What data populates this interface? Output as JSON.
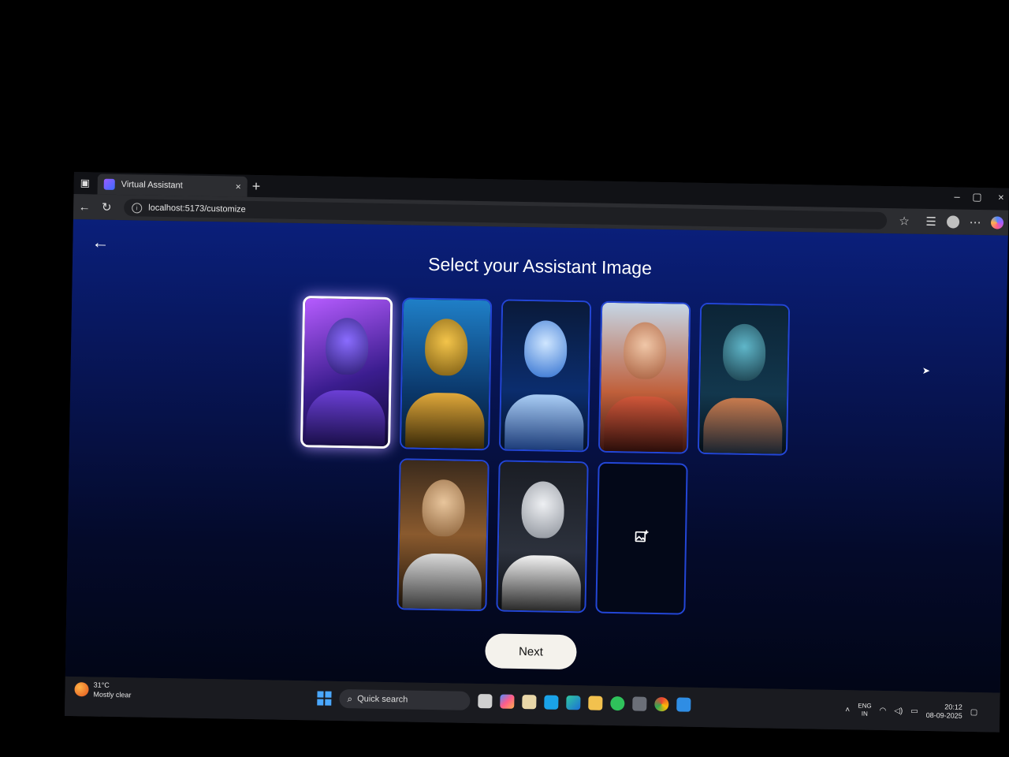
{
  "browser": {
    "tab_title": "Virtual Assistant",
    "tab_close": "×",
    "new_tab": "+",
    "url": "localhost:5173/customize",
    "window_controls": [
      "–",
      "▢",
      "×"
    ]
  },
  "page": {
    "back_icon": "←",
    "title": "Select your Assistant Image",
    "next_label": "Next",
    "upload_icon": "image-plus-icon",
    "cards": [
      {
        "name": "purple-cyborg",
        "selected": true
      },
      {
        "name": "gold-robot",
        "selected": false
      },
      {
        "name": "blue-armor-robot",
        "selected": false
      },
      {
        "name": "cyborg-woman-red",
        "selected": false
      },
      {
        "name": "cyborg-woman-blue",
        "selected": false
      },
      {
        "name": "gold-android-woman",
        "selected": false
      },
      {
        "name": "white-android-woman",
        "selected": false
      }
    ]
  },
  "taskbar": {
    "weather_temp": "31°C",
    "weather_desc": "Mostly clear",
    "search_placeholder": "Quick search",
    "lang_top": "ENG",
    "lang_bottom": "IN",
    "time": "20:12",
    "date": "08-09-2025"
  },
  "colors": {
    "accent_border": "#2346d6",
    "page_top": "#0a1f7a",
    "page_bottom": "#020617",
    "button_bg": "#f4f2ec"
  }
}
